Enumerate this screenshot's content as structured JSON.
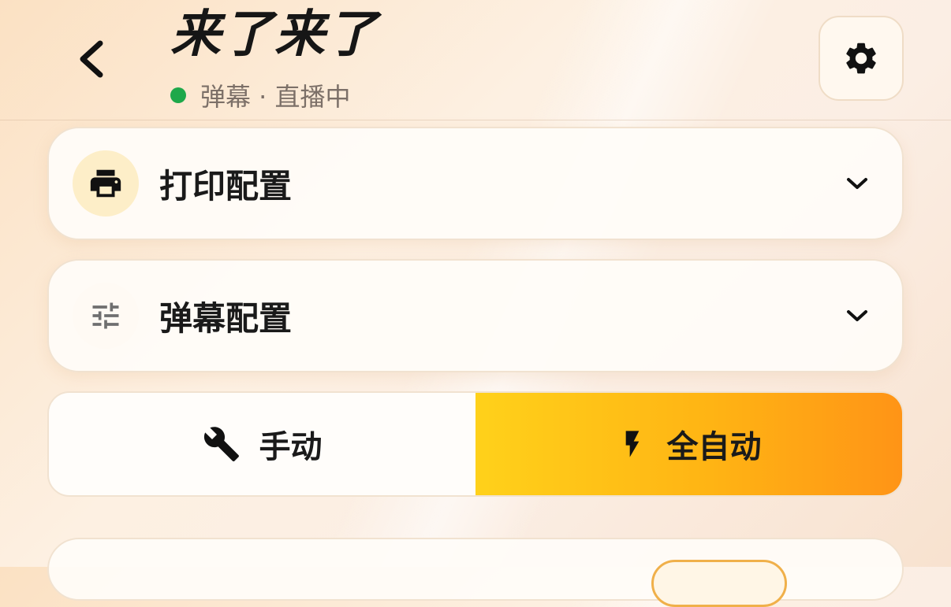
{
  "header": {
    "title": "来了来了",
    "status_text": "弹幕 · 直播中",
    "status_color": "#1ea84a"
  },
  "sections": [
    {
      "label": "打印配置",
      "icon": "printer-icon",
      "icon_bg": "#fdeec8"
    },
    {
      "label": "弹幕配置",
      "icon": "sliders-icon",
      "icon_bg": "#fffaf4"
    }
  ],
  "mode": {
    "manual_label": "手动",
    "manual_icon": "wrench-icon",
    "auto_label": "全自动",
    "auto_icon": "lightning-icon",
    "selected": "auto"
  }
}
